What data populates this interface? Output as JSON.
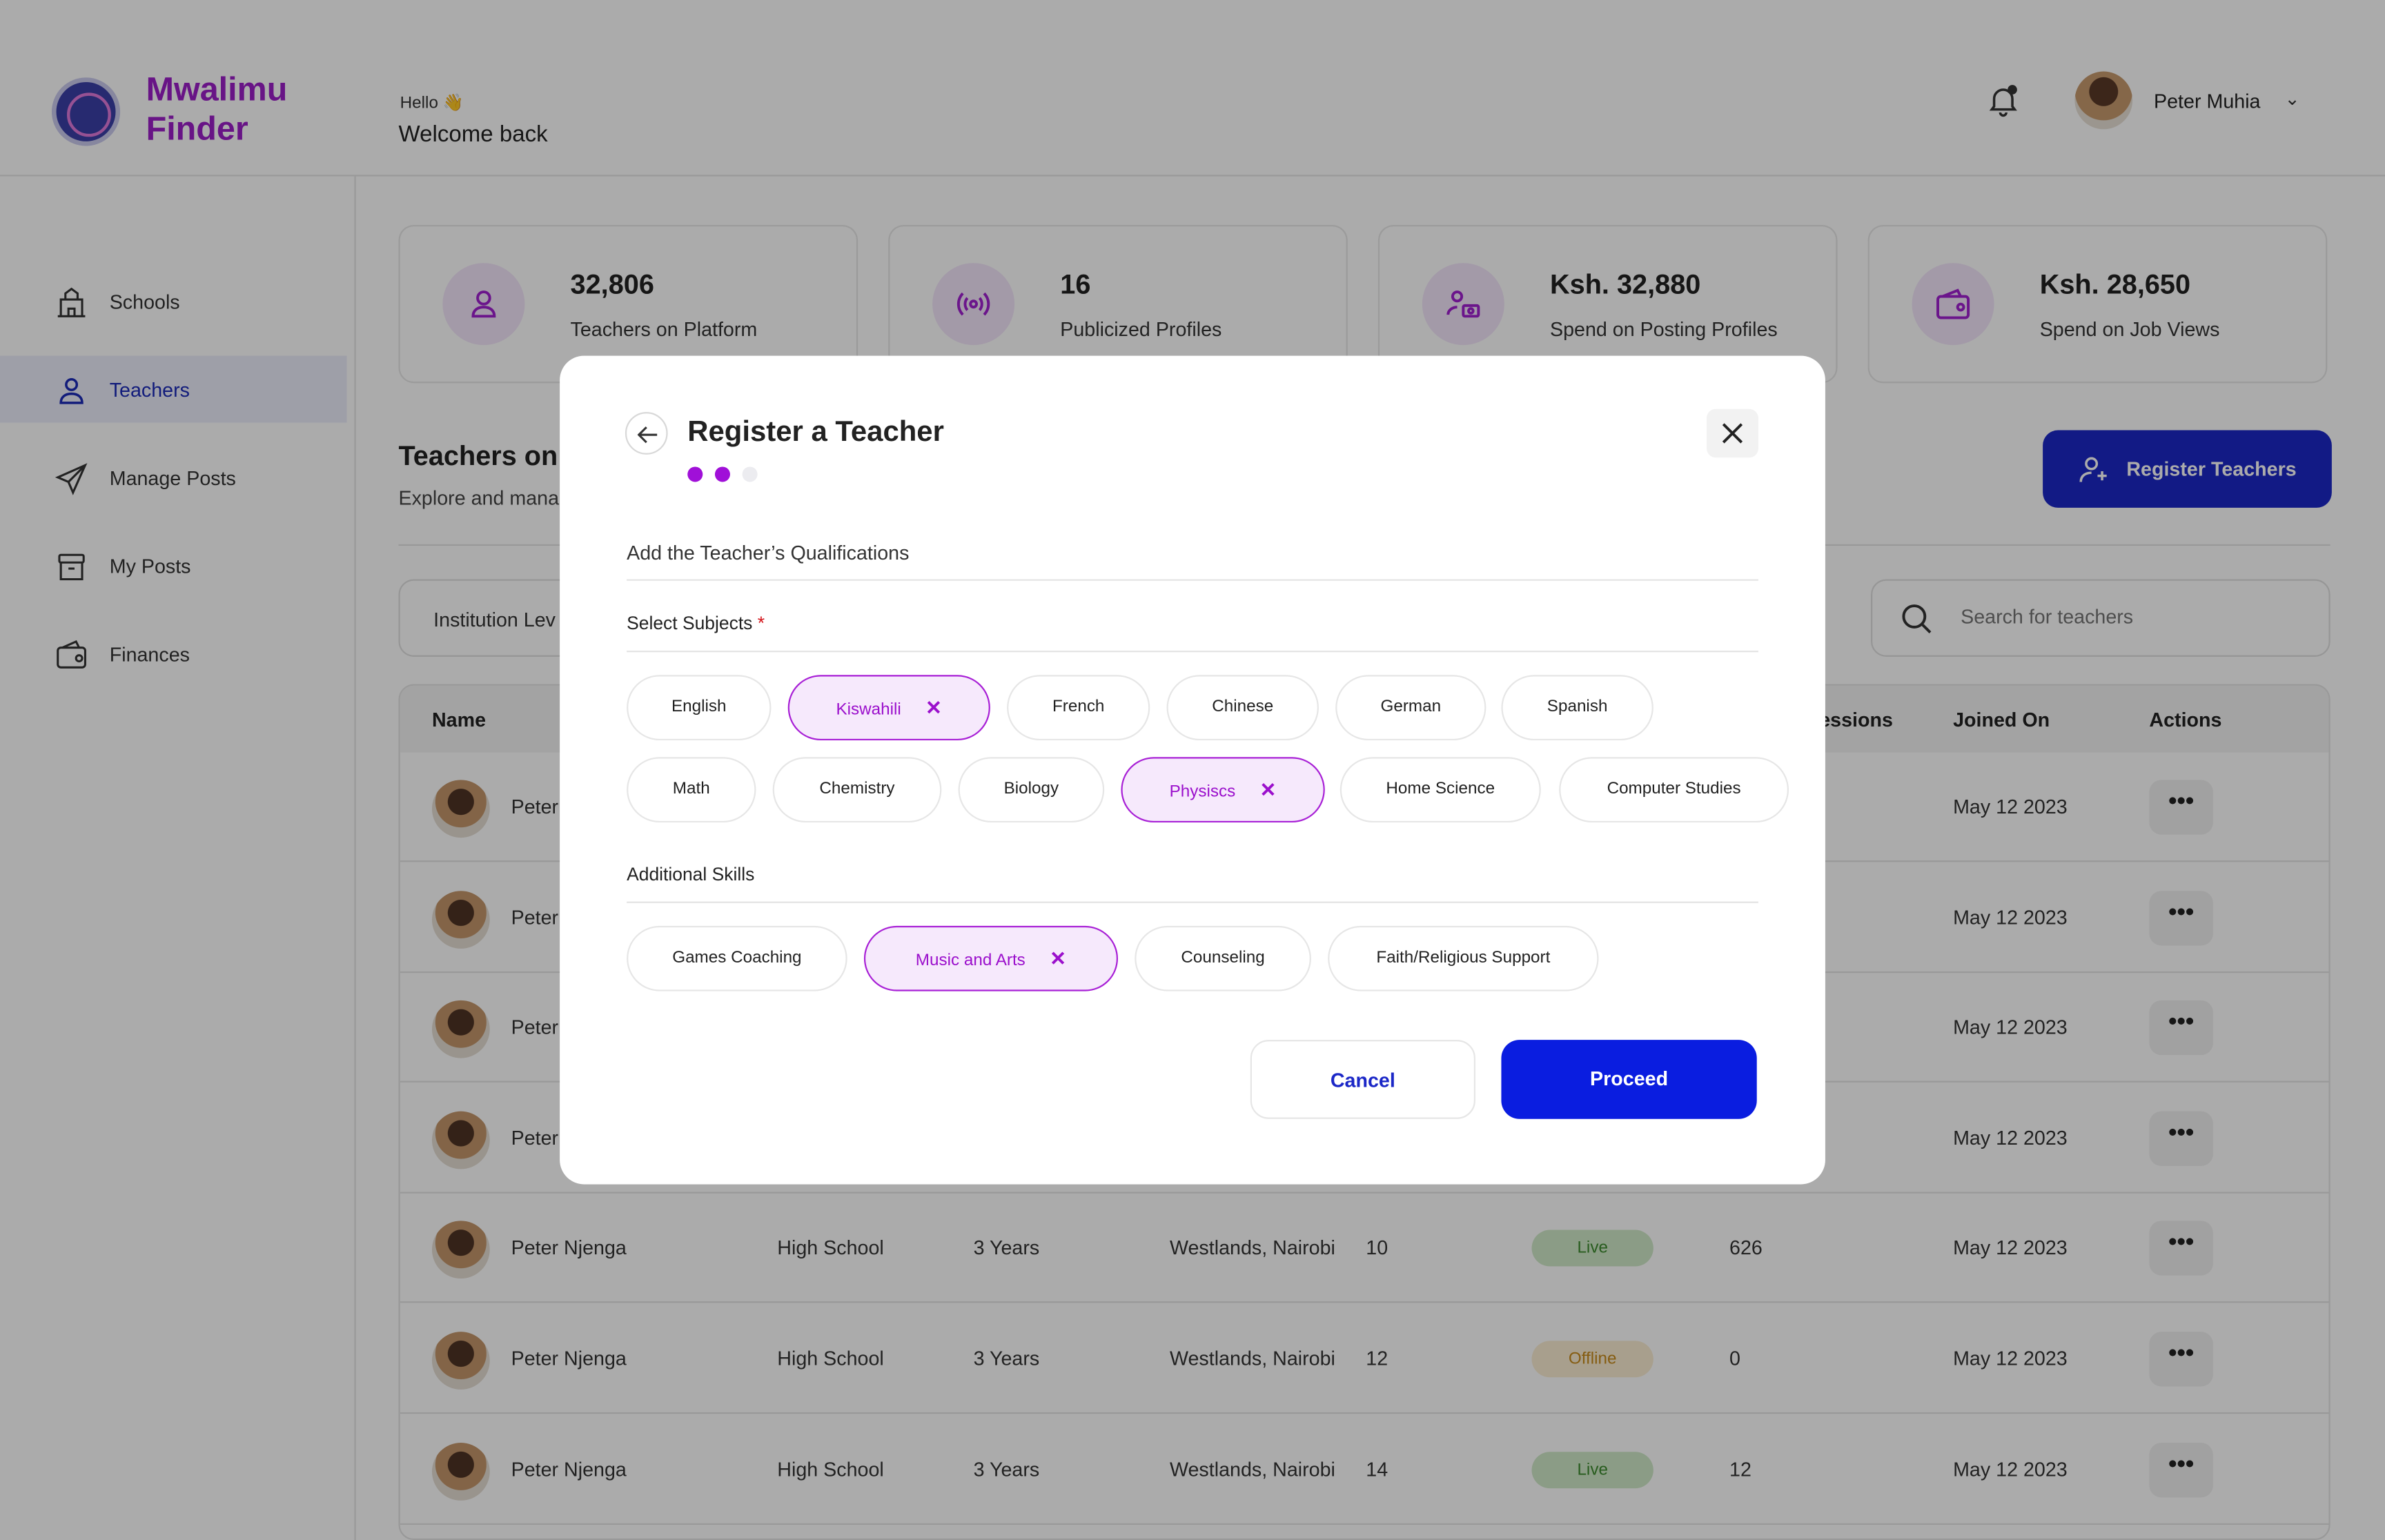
{
  "brand": {
    "name_line1": "Mwalimu",
    "name_line2": "Finder",
    "color": "#9b1ec8"
  },
  "header": {
    "hello": "Hello 👋",
    "welcome": "Welcome back",
    "user_name": "Peter Muhia"
  },
  "sidebar": {
    "items": [
      {
        "label": "Schools",
        "icon": "school-icon",
        "active": false
      },
      {
        "label": "Teachers",
        "icon": "user-icon",
        "active": true
      },
      {
        "label": "Manage Posts",
        "icon": "send-icon",
        "active": false
      },
      {
        "label": "My Posts",
        "icon": "archive-icon",
        "active": false
      },
      {
        "label": "Finances",
        "icon": "wallet-icon",
        "active": false
      }
    ]
  },
  "stats": [
    {
      "value": "32,806",
      "label": "Teachers on Platform",
      "icon": "user-icon"
    },
    {
      "value": "16",
      "label": "Publicized Profiles",
      "icon": "broadcast-icon"
    },
    {
      "value": "Ksh. 32,880",
      "label": "Spend on Posting Profiles",
      "icon": "users-money-icon"
    },
    {
      "value": "Ksh. 28,650",
      "label": "Spend on Job Views",
      "icon": "wallet-icon"
    }
  ],
  "section": {
    "title": "Teachers on",
    "subtitle": "Explore and mana",
    "register_button": "Register Teachers"
  },
  "filter": {
    "label": "Institution Lev"
  },
  "search": {
    "placeholder": "Search for teachers"
  },
  "table": {
    "headers": {
      "name": "Name",
      "impressions": "ressions",
      "joined": "Joined On",
      "actions": "Actions"
    },
    "rows": [
      {
        "name": "Peter",
        "level": "",
        "experience": "",
        "location": "",
        "posts": "",
        "status": "",
        "impressions": "",
        "joined": "May 12 2023"
      },
      {
        "name": "Peter",
        "level": "",
        "experience": "",
        "location": "",
        "posts": "",
        "status": "",
        "impressions": "",
        "joined": "May 12 2023"
      },
      {
        "name": "Peter",
        "level": "",
        "experience": "",
        "location": "",
        "posts": "",
        "status": "",
        "impressions": "",
        "joined": "May 12 2023"
      },
      {
        "name": "Peter",
        "level": "",
        "experience": "",
        "location": "",
        "posts": "",
        "status": "",
        "impressions": "",
        "joined": "May 12 2023"
      },
      {
        "name": "Peter Njenga",
        "level": "High School",
        "experience": "3 Years",
        "location": "Westlands, Nairobi",
        "posts": "10",
        "status": "Live",
        "impressions": "626",
        "joined": "May 12 2023"
      },
      {
        "name": "Peter Njenga",
        "level": "High School",
        "experience": "3 Years",
        "location": "Westlands, Nairobi",
        "posts": "12",
        "status": "Offline",
        "impressions": "0",
        "joined": "May 12 2023"
      },
      {
        "name": "Peter Njenga",
        "level": "High School",
        "experience": "3 Years",
        "location": "Westlands, Nairobi",
        "posts": "14",
        "status": "Live",
        "impressions": "12",
        "joined": "May 12 2023"
      }
    ],
    "actions_glyph": "•••"
  },
  "modal": {
    "title": "Register a Teacher",
    "steps_total": 3,
    "steps_done": 2,
    "subtitle": "Add the Teacher’s Qualifications",
    "subjects_label": "Select Subjects",
    "required_mark": "*",
    "subjects": [
      {
        "label": "English",
        "selected": false
      },
      {
        "label": "Kiswahili",
        "selected": true
      },
      {
        "label": "French",
        "selected": false
      },
      {
        "label": "Chinese",
        "selected": false
      },
      {
        "label": "German",
        "selected": false
      },
      {
        "label": "Spanish",
        "selected": false
      },
      {
        "label": "Math",
        "selected": false
      },
      {
        "label": "Chemistry",
        "selected": false
      },
      {
        "label": "Biology",
        "selected": false
      },
      {
        "label": "Physiscs",
        "selected": true
      },
      {
        "label": "Home Science",
        "selected": false
      },
      {
        "label": "Computer Studies",
        "selected": false
      }
    ],
    "skills_label": "Additional Skills",
    "skills": [
      {
        "label": "Games Coaching",
        "selected": false
      },
      {
        "label": "Music and Arts",
        "selected": true
      },
      {
        "label": "Counseling",
        "selected": false
      },
      {
        "label": "Faith/Religious Support",
        "selected": false
      }
    ],
    "remove_glyph": "✕",
    "cancel": "Cancel",
    "proceed": "Proceed"
  },
  "colors": {
    "accent": "#9b10cc",
    "primary": "#0a1de0",
    "live_bg": "#cfe9c8",
    "live_fg": "#3c8a2e",
    "offline_bg": "#fbeed3",
    "offline_fg": "#c68a1a"
  }
}
